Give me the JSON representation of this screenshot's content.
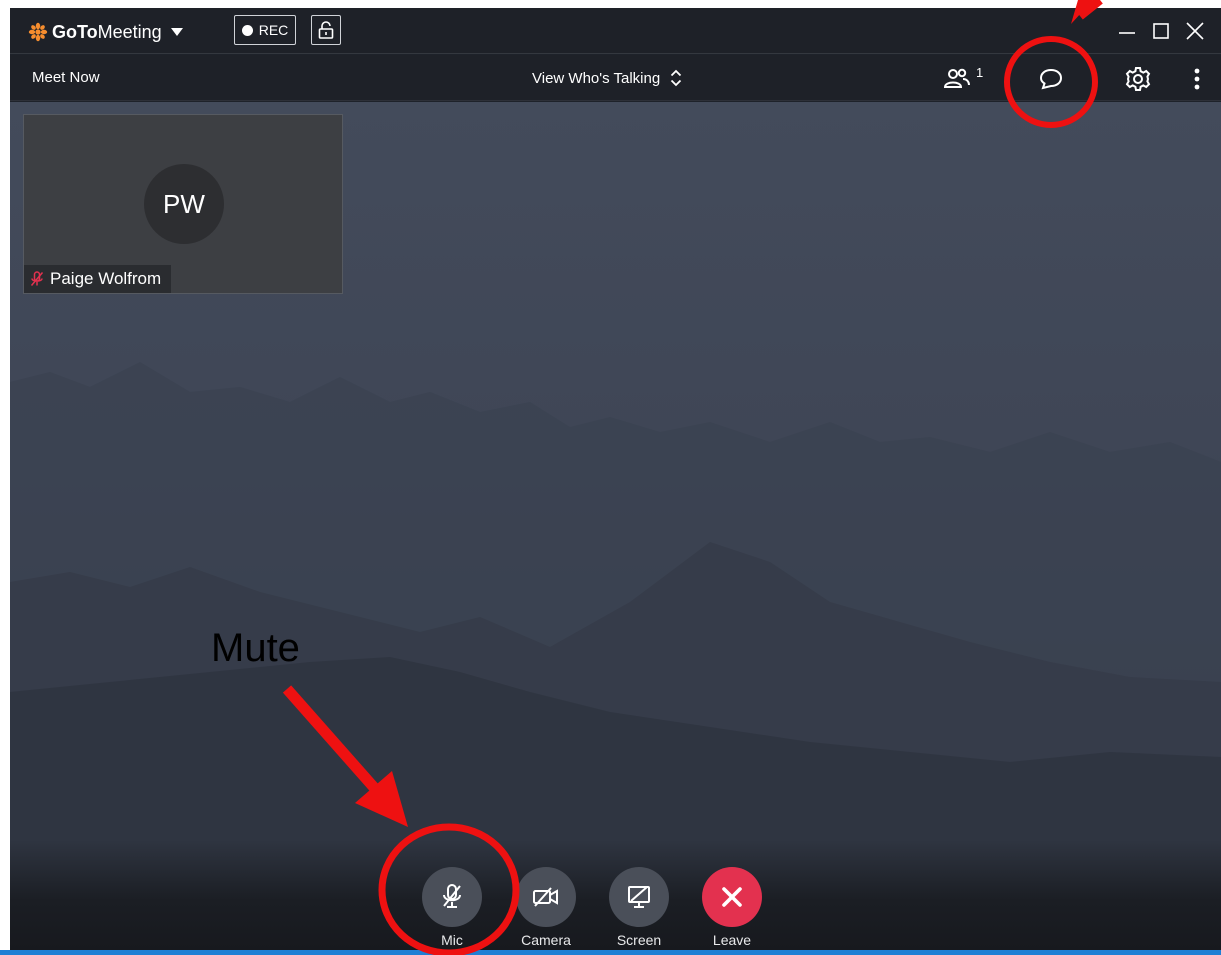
{
  "app": {
    "brand_bold": "GoTo",
    "brand_light": "Meeting",
    "rec_label": "REC"
  },
  "toolbar": {
    "meet_now": "Meet Now",
    "view_mode": "View Who's Talking",
    "attendee_count": "1"
  },
  "participant": {
    "initials": "PW",
    "name": "Paige Wolfrom",
    "muted": true
  },
  "controls": [
    {
      "label": "Mic",
      "icon": "mic-muted-icon"
    },
    {
      "label": "Camera",
      "icon": "camera-off-icon"
    },
    {
      "label": "Screen",
      "icon": "screen-share-off-icon"
    },
    {
      "label": "Leave",
      "icon": "close-icon"
    }
  ],
  "annotation": {
    "mute_text": "Mute",
    "color": "#ee1111"
  },
  "colors": {
    "brand_orange": "#f68d2e",
    "leave_red": "#e3314f",
    "muted_red": "#e3314f"
  }
}
